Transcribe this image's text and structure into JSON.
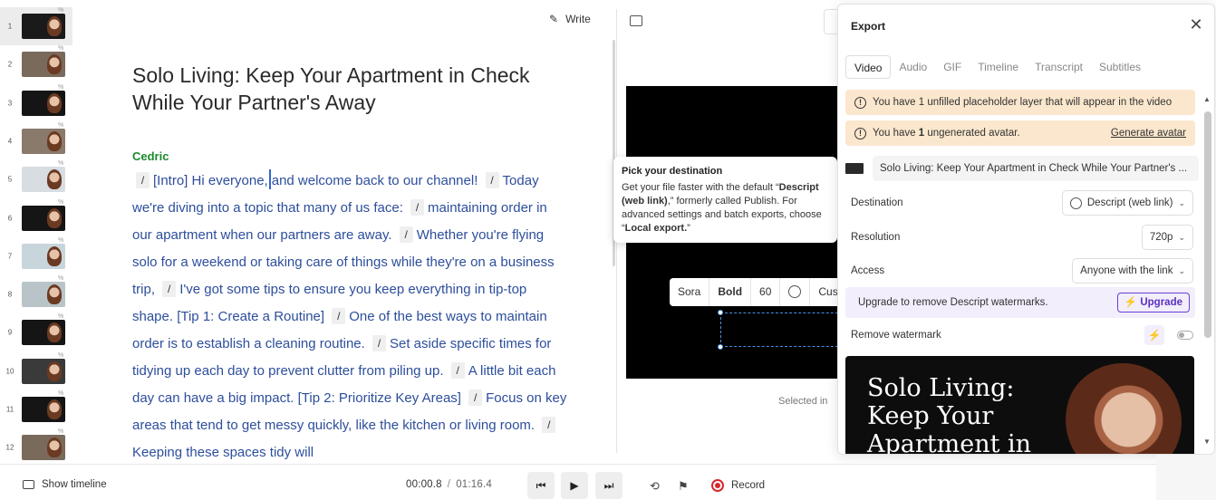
{
  "thumbnails": [
    {
      "num": "1",
      "active": true,
      "bg": "#1a1a1a"
    },
    {
      "num": "2",
      "active": false,
      "bg": "#7a6a5c"
    },
    {
      "num": "3",
      "active": false,
      "bg": "#151515"
    },
    {
      "num": "4",
      "active": false,
      "bg": "#8a7a6c"
    },
    {
      "num": "5",
      "active": false,
      "bg": "#d8dde2"
    },
    {
      "num": "6",
      "active": false,
      "bg": "#151515"
    },
    {
      "num": "7",
      "active": false,
      "bg": "#c8d6dc"
    },
    {
      "num": "8",
      "active": false,
      "bg": "#b8c4c8"
    },
    {
      "num": "9",
      "active": false,
      "bg": "#151515"
    },
    {
      "num": "10",
      "active": false,
      "bg": "#3a3a3a"
    },
    {
      "num": "11",
      "active": false,
      "bg": "#151515"
    },
    {
      "num": "12",
      "active": false,
      "bg": "#7a6a5c"
    }
  ],
  "editor": {
    "write_label": "Write",
    "title": "Solo Living: Keep Your Apartment in Check While Your Partner's Away",
    "speaker": "Cedric",
    "seg": [
      "[Intro] Hi everyone,",
      "and welcome back to our channel!",
      "Today we're diving into a topic that many of us face:",
      "maintaining order in our apartment when our partners are away.",
      "Whether you're flying solo for a weekend or taking care of things while they're on a business trip,",
      "I've got some tips to ensure you keep everything in tip-top shape. [Tip 1: Create a Routine]",
      "One of the best ways to maintain order is to establish a cleaning routine.",
      "Set aside specific times for tidying up each day to prevent clutter from piling up.",
      "A little bit each day can have a big impact. [Tip 2: Prioritize Key Areas]",
      "Focus on key areas that tend to get messy quickly, like the kitchen or living room.",
      "Keeping these spaces tidy will"
    ]
  },
  "canvas": {
    "style_bar": {
      "font": "Sora",
      "weight": "Bold",
      "size": "60",
      "more": "Cust"
    },
    "selected_in": "Selected in"
  },
  "tooltip": {
    "title": "Pick your destination",
    "line1": "Get your file faster with the default “",
    "bold1": "Descript (web link)",
    "line2": ",” formerly called Publish. For advanced settings and batch exports, choose “",
    "bold2": "Local export.",
    "line3": "”"
  },
  "export": {
    "title": "Export",
    "tabs": [
      "Video",
      "Audio",
      "GIF",
      "Timeline",
      "Transcript",
      "Subtitles"
    ],
    "active_tab": "Video",
    "warning1": "You have 1 unfilled placeholder layer that will appear in the video",
    "warning2_pre": "You have ",
    "warning2_bold": "1",
    "warning2_post": " ungenerated avatar.",
    "generate_avatar": "Generate avatar",
    "composition_name": "Solo Living: Keep Your Apartment in Check While Your Partner's ...",
    "destination_label": "Destination",
    "destination_value": "Descript (web link)",
    "resolution_label": "Resolution",
    "resolution_value": "720p",
    "access_label": "Access",
    "access_value": "Anyone with the link",
    "upgrade_text": "Upgrade to remove Descript watermarks.",
    "upgrade_btn": "Upgrade",
    "remove_watermark": "Remove watermark",
    "preview_title": "Solo Living: Keep Your Apartment in"
  },
  "transport": {
    "show_timeline": "Show timeline",
    "current": "00:00.8",
    "separator": "/",
    "total": "01:16.4",
    "record": "Record"
  },
  "colors": {
    "accent": "#6a3fd0",
    "warning_bg": "#fbe7cd",
    "speaker": "#1c8a2e",
    "script": "#2d4e9c",
    "record": "#d9262c"
  }
}
